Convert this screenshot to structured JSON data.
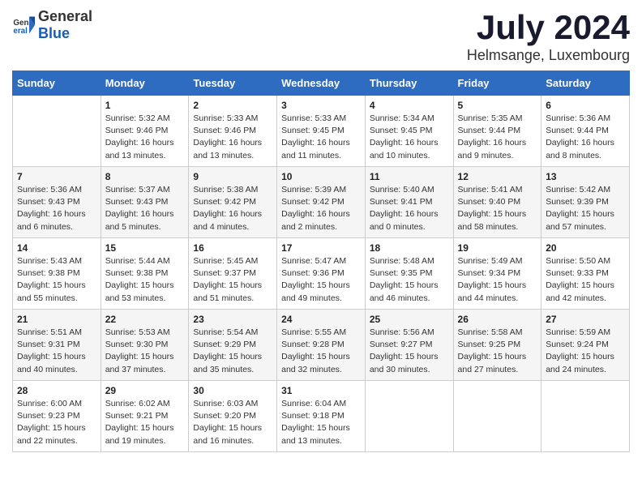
{
  "header": {
    "logo_general": "General",
    "logo_blue": "Blue",
    "month_title": "July 2024",
    "location": "Helmsange, Luxembourg"
  },
  "calendar": {
    "days_of_week": [
      "Sunday",
      "Monday",
      "Tuesday",
      "Wednesday",
      "Thursday",
      "Friday",
      "Saturday"
    ],
    "weeks": [
      [
        {
          "day": "",
          "info": ""
        },
        {
          "day": "1",
          "info": "Sunrise: 5:32 AM\nSunset: 9:46 PM\nDaylight: 16 hours\nand 13 minutes."
        },
        {
          "day": "2",
          "info": "Sunrise: 5:33 AM\nSunset: 9:46 PM\nDaylight: 16 hours\nand 13 minutes."
        },
        {
          "day": "3",
          "info": "Sunrise: 5:33 AM\nSunset: 9:45 PM\nDaylight: 16 hours\nand 11 minutes."
        },
        {
          "day": "4",
          "info": "Sunrise: 5:34 AM\nSunset: 9:45 PM\nDaylight: 16 hours\nand 10 minutes."
        },
        {
          "day": "5",
          "info": "Sunrise: 5:35 AM\nSunset: 9:44 PM\nDaylight: 16 hours\nand 9 minutes."
        },
        {
          "day": "6",
          "info": "Sunrise: 5:36 AM\nSunset: 9:44 PM\nDaylight: 16 hours\nand 8 minutes."
        }
      ],
      [
        {
          "day": "7",
          "info": "Sunrise: 5:36 AM\nSunset: 9:43 PM\nDaylight: 16 hours\nand 6 minutes."
        },
        {
          "day": "8",
          "info": "Sunrise: 5:37 AM\nSunset: 9:43 PM\nDaylight: 16 hours\nand 5 minutes."
        },
        {
          "day": "9",
          "info": "Sunrise: 5:38 AM\nSunset: 9:42 PM\nDaylight: 16 hours\nand 4 minutes."
        },
        {
          "day": "10",
          "info": "Sunrise: 5:39 AM\nSunset: 9:42 PM\nDaylight: 16 hours\nand 2 minutes."
        },
        {
          "day": "11",
          "info": "Sunrise: 5:40 AM\nSunset: 9:41 PM\nDaylight: 16 hours\nand 0 minutes."
        },
        {
          "day": "12",
          "info": "Sunrise: 5:41 AM\nSunset: 9:40 PM\nDaylight: 15 hours\nand 58 minutes."
        },
        {
          "day": "13",
          "info": "Sunrise: 5:42 AM\nSunset: 9:39 PM\nDaylight: 15 hours\nand 57 minutes."
        }
      ],
      [
        {
          "day": "14",
          "info": "Sunrise: 5:43 AM\nSunset: 9:38 PM\nDaylight: 15 hours\nand 55 minutes."
        },
        {
          "day": "15",
          "info": "Sunrise: 5:44 AM\nSunset: 9:38 PM\nDaylight: 15 hours\nand 53 minutes."
        },
        {
          "day": "16",
          "info": "Sunrise: 5:45 AM\nSunset: 9:37 PM\nDaylight: 15 hours\nand 51 minutes."
        },
        {
          "day": "17",
          "info": "Sunrise: 5:47 AM\nSunset: 9:36 PM\nDaylight: 15 hours\nand 49 minutes."
        },
        {
          "day": "18",
          "info": "Sunrise: 5:48 AM\nSunset: 9:35 PM\nDaylight: 15 hours\nand 46 minutes."
        },
        {
          "day": "19",
          "info": "Sunrise: 5:49 AM\nSunset: 9:34 PM\nDaylight: 15 hours\nand 44 minutes."
        },
        {
          "day": "20",
          "info": "Sunrise: 5:50 AM\nSunset: 9:33 PM\nDaylight: 15 hours\nand 42 minutes."
        }
      ],
      [
        {
          "day": "21",
          "info": "Sunrise: 5:51 AM\nSunset: 9:31 PM\nDaylight: 15 hours\nand 40 minutes."
        },
        {
          "day": "22",
          "info": "Sunrise: 5:53 AM\nSunset: 9:30 PM\nDaylight: 15 hours\nand 37 minutes."
        },
        {
          "day": "23",
          "info": "Sunrise: 5:54 AM\nSunset: 9:29 PM\nDaylight: 15 hours\nand 35 minutes."
        },
        {
          "day": "24",
          "info": "Sunrise: 5:55 AM\nSunset: 9:28 PM\nDaylight: 15 hours\nand 32 minutes."
        },
        {
          "day": "25",
          "info": "Sunrise: 5:56 AM\nSunset: 9:27 PM\nDaylight: 15 hours\nand 30 minutes."
        },
        {
          "day": "26",
          "info": "Sunrise: 5:58 AM\nSunset: 9:25 PM\nDaylight: 15 hours\nand 27 minutes."
        },
        {
          "day": "27",
          "info": "Sunrise: 5:59 AM\nSunset: 9:24 PM\nDaylight: 15 hours\nand 24 minutes."
        }
      ],
      [
        {
          "day": "28",
          "info": "Sunrise: 6:00 AM\nSunset: 9:23 PM\nDaylight: 15 hours\nand 22 minutes."
        },
        {
          "day": "29",
          "info": "Sunrise: 6:02 AM\nSunset: 9:21 PM\nDaylight: 15 hours\nand 19 minutes."
        },
        {
          "day": "30",
          "info": "Sunrise: 6:03 AM\nSunset: 9:20 PM\nDaylight: 15 hours\nand 16 minutes."
        },
        {
          "day": "31",
          "info": "Sunrise: 6:04 AM\nSunset: 9:18 PM\nDaylight: 15 hours\nand 13 minutes."
        },
        {
          "day": "",
          "info": ""
        },
        {
          "day": "",
          "info": ""
        },
        {
          "day": "",
          "info": ""
        }
      ]
    ]
  }
}
